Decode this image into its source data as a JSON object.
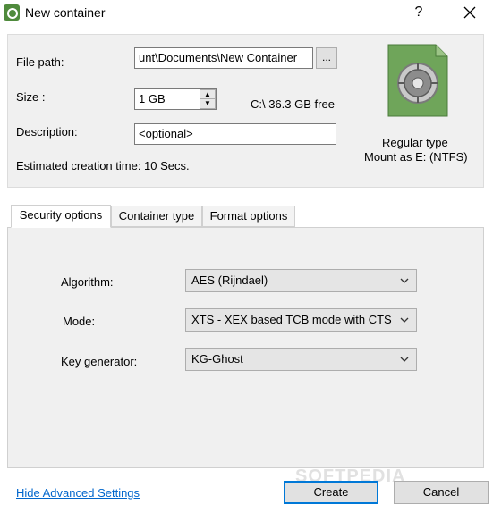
{
  "window": {
    "title": "New container",
    "help_glyph": "?"
  },
  "form": {
    "file_path_label": "File path:",
    "file_path_value": "unt\\Documents\\New Container",
    "browse_label": "...",
    "size_label": "Size :",
    "size_value": "1 GB",
    "free_space": "C:\\ 36.3 GB free",
    "description_label": "Description:",
    "description_value": "<optional>",
    "estimated_time": "Estimated creation time: 10 Secs."
  },
  "container_info": {
    "type_text": "Regular type",
    "mount_text": "Mount as E: (NTFS)"
  },
  "tabs": [
    {
      "label": "Security options"
    },
    {
      "label": "Container type"
    },
    {
      "label": "Format options"
    }
  ],
  "security": {
    "algorithm_label": "Algorithm:",
    "algorithm_value": "AES (Rijndael)",
    "mode_label": "Mode:",
    "mode_value": "XTS - XEX based TCB mode with CTS",
    "keygen_label": "Key generator:",
    "keygen_value": "KG-Ghost"
  },
  "footer": {
    "advanced_link": "Hide Advanced Settings",
    "create_label": "Create",
    "cancel_label": "Cancel",
    "watermark": "SOFTPEDIA"
  },
  "colors": {
    "accent": "#0078d7",
    "link": "#0066cc",
    "icon_green": "#6fa55a"
  }
}
